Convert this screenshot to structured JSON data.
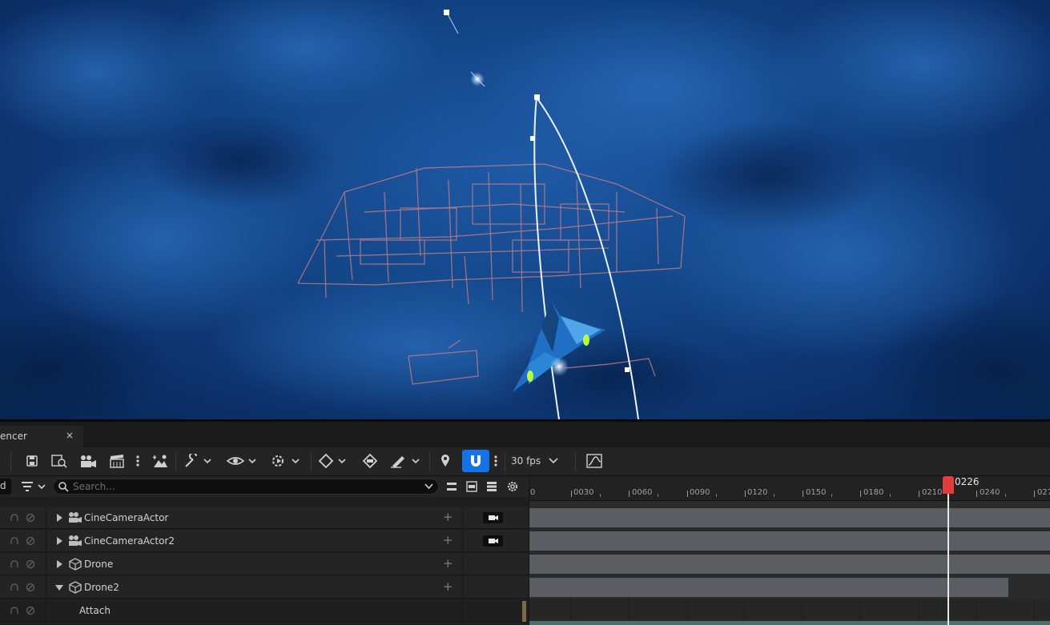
{
  "tab": {
    "label": "encer",
    "close": "×"
  },
  "toolbar": {
    "fps": "30 fps",
    "icons": [
      "save-icon",
      "browse-icon",
      "camera-icon",
      "clapper-icon",
      "more-icon",
      "scene-icon",
      "wrench-icon",
      "eye-icon",
      "playback-settings-icon",
      "key-icon",
      "key-edit-icon",
      "curve-brush-icon",
      "marker-icon",
      "snap-magnet-icon",
      "more-icon",
      "curve-editor-icon"
    ]
  },
  "outliner": {
    "left_label": "d",
    "search_placeholder": "Search...",
    "rows": [
      {
        "label": "CineCameraActor",
        "expanded": false,
        "camera_button": true
      },
      {
        "label": "CineCameraActor2",
        "expanded": false,
        "camera_button": true
      },
      {
        "label": "Drone",
        "expanded": false,
        "camera_button": false
      },
      {
        "label": "Drone2",
        "expanded": true,
        "camera_button": false
      },
      {
        "label": "Attach",
        "expanded": null,
        "camera_button": false
      }
    ]
  },
  "timeline": {
    "current_frame": "0226",
    "ticks": [
      "0",
      "0030",
      "0060",
      "0090",
      "0120",
      "0150",
      "0180",
      "0210",
      "0240",
      "027"
    ]
  },
  "colors": {
    "accent": "#1473e6",
    "playhead": "#e33b3b"
  }
}
